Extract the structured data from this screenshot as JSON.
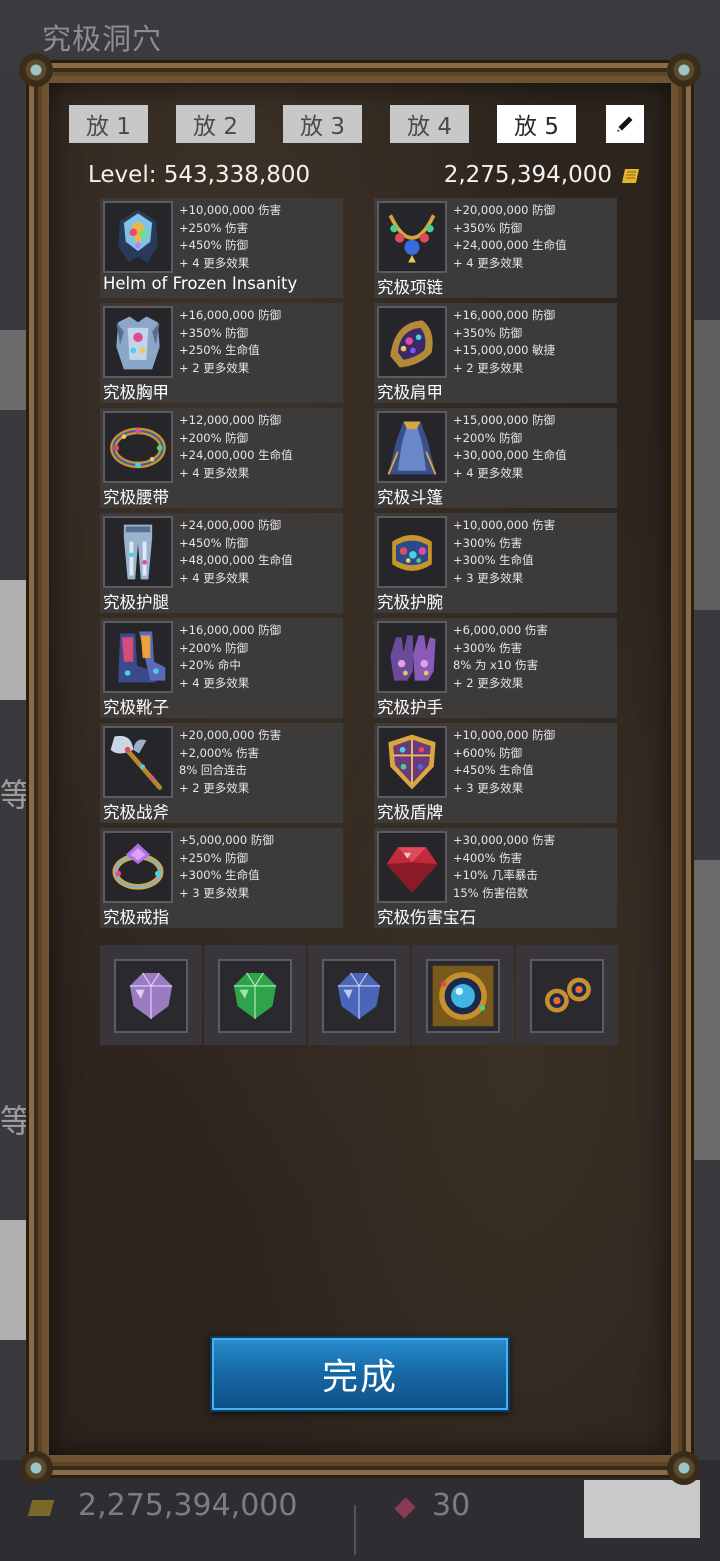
{
  "background": {
    "title": "究极洞穴",
    "side_char": "等",
    "gold_value": "2,275,394,000",
    "gem_value": "30"
  },
  "tabs": [
    {
      "label": "放 1",
      "active": false
    },
    {
      "label": "放 2",
      "active": false
    },
    {
      "label": "放 3",
      "active": false
    },
    {
      "label": "放 4",
      "active": false
    },
    {
      "label": "放 5",
      "active": true
    }
  ],
  "edit_icon": "pencil-icon",
  "level_label": "Level: 543,338,800",
  "gold_total": "2,275,394,000",
  "equipment": [
    {
      "name": "Helm of Frozen Insanity",
      "icon": "helm-icon",
      "stats": [
        "+10,000,000 伤害",
        "+250% 伤害",
        "+450% 防御",
        "+ 4 更多效果"
      ]
    },
    {
      "name": "究极项链",
      "icon": "necklace-icon",
      "stats": [
        "+20,000,000 防御",
        "+350% 防御",
        "+24,000,000 生命值",
        "+ 4 更多效果"
      ]
    },
    {
      "name": "究极胸甲",
      "icon": "chestplate-icon",
      "stats": [
        "+16,000,000 防御",
        "+350% 防御",
        "+250% 生命值",
        "+ 2 更多效果"
      ]
    },
    {
      "name": "究极肩甲",
      "icon": "shoulder-icon",
      "stats": [
        "+16,000,000 防御",
        "+350% 防御",
        "+15,000,000 敏捷",
        "+ 2 更多效果"
      ]
    },
    {
      "name": "究极腰带",
      "icon": "belt-icon",
      "stats": [
        "+12,000,000 防御",
        "+200% 防御",
        "+24,000,000 生命值",
        "+ 4 更多效果"
      ]
    },
    {
      "name": "究极斗篷",
      "icon": "cloak-icon",
      "stats": [
        "+15,000,000 防御",
        "+200% 防御",
        "+30,000,000 生命值",
        "+ 4 更多效果"
      ]
    },
    {
      "name": "究极护腿",
      "icon": "leggings-icon",
      "stats": [
        "+24,000,000 防御",
        "+450% 防御",
        "+48,000,000 生命值",
        "+ 4 更多效果"
      ]
    },
    {
      "name": "究极护腕",
      "icon": "bracer-icon",
      "stats": [
        "+10,000,000 伤害",
        "+300% 伤害",
        "+300% 生命值",
        "+ 3 更多效果"
      ]
    },
    {
      "name": "究极靴子",
      "icon": "boots-icon",
      "stats": [
        "+16,000,000 防御",
        "+200% 防御",
        "+20% 命中",
        "+ 4 更多效果"
      ]
    },
    {
      "name": "究极护手",
      "icon": "gloves-icon",
      "stats": [
        "+6,000,000 伤害",
        "+300% 伤害",
        "8% 为 x10 伤害",
        "+ 2 更多效果"
      ]
    },
    {
      "name": "究极战斧",
      "icon": "axe-icon",
      "stats": [
        "+20,000,000 伤害",
        "+2,000% 伤害",
        "8% 回合连击",
        "+ 2 更多效果"
      ]
    },
    {
      "name": "究极盾牌",
      "icon": "shield-icon",
      "stats": [
        "+10,000,000 防御",
        "+600% 防御",
        "+450% 生命值",
        "+ 3 更多效果"
      ]
    },
    {
      "name": "究极戒指",
      "icon": "ring-icon",
      "stats": [
        "+5,000,000 防御",
        "+250% 防御",
        "+300% 生命值",
        "+ 3 更多效果"
      ]
    },
    {
      "name": "究极伤害宝石",
      "icon": "red-gem-icon",
      "stats": [
        "+30,000,000 伤害",
        "+400% 伤害",
        "+10% 几率暴击",
        "15% 伤害倍数"
      ]
    }
  ],
  "gems": [
    {
      "icon": "purple-gem-icon",
      "color": "#9b7bc2"
    },
    {
      "icon": "green-gem-icon",
      "color": "#2fa34a"
    },
    {
      "icon": "blue-gem-icon",
      "color": "#4a66b8"
    },
    {
      "icon": "amulet-icon",
      "color": "#3fb6e6"
    },
    {
      "icon": "earrings-icon",
      "color": "#c8902c"
    }
  ],
  "done_label": "完成",
  "colors": {
    "panel": "#2c241d",
    "frame": "#6e5433",
    "card": "#3d3a3a",
    "tab": "#c8c8c8",
    "tab_active": "#ffffff",
    "button": "#176aa8",
    "coin": "#e0b52c"
  }
}
